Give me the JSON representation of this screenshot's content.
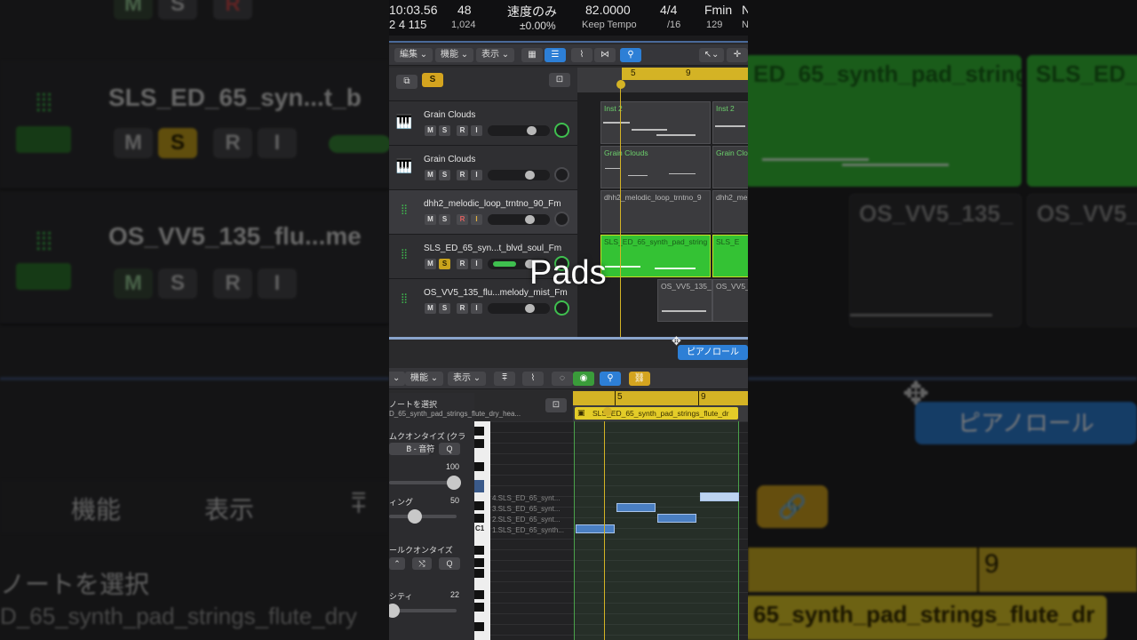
{
  "lcd": {
    "time": "10:03.56",
    "bars": "2  4  115",
    "bpm_top": "48",
    "bpm_sub": "1,024",
    "mode": "速度のみ",
    "percent": "±0.00%",
    "tempo": "82.0000",
    "keep_tempo": "Keep Tempo",
    "signature": "4/4",
    "division": "/16",
    "key": "Fmin",
    "key_sub": "129",
    "n1": "N",
    "n2": "N"
  },
  "arrange_toolbar": {
    "edit": "編集",
    "func": "機能",
    "view": "表示"
  },
  "solo_badge": "S",
  "ruler": {
    "m5": "5",
    "m9": "9"
  },
  "tracks": [
    {
      "name": "Grain Clouds",
      "m": "M",
      "s": "S",
      "r": "R",
      "i": "I"
    },
    {
      "name": "Grain Clouds",
      "m": "M",
      "s": "S",
      "r": "R",
      "i": "I"
    },
    {
      "name": "dhh2_melodic_loop_trntno_90_Fm",
      "m": "M",
      "s": "S",
      "r": "R",
      "i": "I"
    },
    {
      "name": "SLS_ED_65_syn...t_blvd_soul_Fm",
      "m": "M",
      "s": "S",
      "r": "R",
      "i": "I"
    },
    {
      "name": "OS_VV5_135_flu...melody_mist_Fm",
      "m": "M",
      "s": "S",
      "r": "R",
      "i": "I"
    }
  ],
  "regions": {
    "inst2a": "Inst 2",
    "inst2b": "Inst 2",
    "grain_a": "Grain Clouds",
    "grain_b": "Grain Clo",
    "dhh_a": "dhh2_melodic_loop_trntno_9",
    "dhh_b": "dhh2_me",
    "sls_a": "SLS_ED_65_synth_pad_string",
    "sls_b": "SLS_E",
    "os_a": "OS_VV5_135_",
    "os_b": "OS_VV5_"
  },
  "overlay_text": "Pads",
  "piano_roll_tab": "ピアノロール",
  "editor_toolbar": {
    "func": "機能",
    "view": "表示"
  },
  "inspector": {
    "select_notes": "ノートを選択",
    "region_name": "D_65_synth_pad_strings_flute_dry_hea...",
    "time_quantize": "ムクオンタイズ (クラ",
    "note_value": "B - 音符",
    "q": "Q",
    "strength_val": "100",
    "swing_label": "ィング",
    "swing_val": "50",
    "scale_quantize": "ールクオンタイズ",
    "q2": "Q",
    "velocity_label": "シティ",
    "velocity_val": "22"
  },
  "piano_region": "SLS_ED_65_synth_pad_strings_flute_dr",
  "piano_ruler": {
    "m5": "5",
    "m9": "9"
  },
  "piano_notes_labels": {
    "n4": "4.SLS_ED_65_synt...",
    "n3": "3.SLS_ED_65_synt...",
    "n2": "2.SLS_ED_65_synt...",
    "n1": "1.SLS_ED_65_synth...",
    "c1": "C1"
  },
  "blur_left": {
    "solo_top": "S",
    "r_top": "R",
    "m_top": "M",
    "track1": "SLS_ED_65_syn...t_b",
    "track2": "OS_VV5_135_flu...me",
    "btn_m": "M",
    "btn_s": "S",
    "btn_r": "R",
    "btn_i": "I",
    "func": "機能",
    "view": "表示",
    "select_notes": "ノートを選択",
    "region": "D_65_synth_pad_strings_flute_dry"
  },
  "blur_right": {
    "region1": "ED_65_synth_pad_string",
    "region2": "SLS_ED_",
    "region3": "OS_VV5_135_",
    "region4": "OS_VV5_",
    "piano_tab": "ピアノロール",
    "bar9": "9",
    "region5": "65_synth_pad_strings_flute_dr"
  },
  "colors": {
    "accent_yellow": "#d4b325",
    "green": "#34c234",
    "blue": "#2d7fd6"
  }
}
